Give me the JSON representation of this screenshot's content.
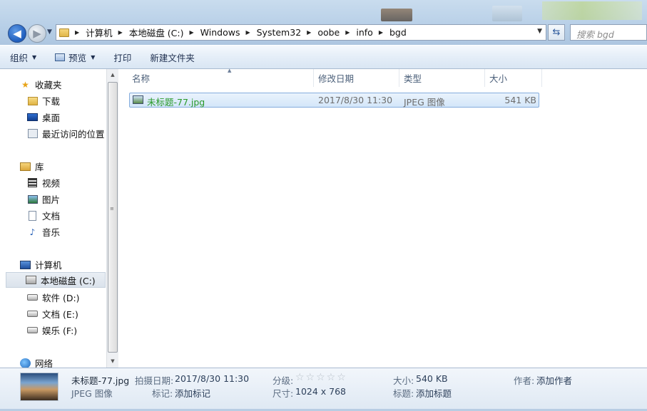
{
  "address": {
    "crumbs": [
      "计算机",
      "本地磁盘 (C:)",
      "Windows",
      "System32",
      "oobe",
      "info",
      "bgd"
    ],
    "search_placeholder": "搜索 bgd"
  },
  "toolbar": {
    "organize": "组织",
    "preview": "预览",
    "print": "打印",
    "new_folder": "新建文件夹"
  },
  "sidebar": {
    "favorites": "收藏夹",
    "downloads": "下载",
    "desktop": "桌面",
    "recent": "最近访问的位置",
    "libraries": "库",
    "videos": "视频",
    "pictures": "图片",
    "documents": "文档",
    "music": "音乐",
    "computer": "计算机",
    "drive_c": "本地磁盘 (C:)",
    "drive_d": "软件 (D:)",
    "drive_e": "文档 (E:)",
    "drive_f": "娱乐 (F:)",
    "network": "网络"
  },
  "columns": {
    "name": "名称",
    "modified": "修改日期",
    "type": "类型",
    "size": "大小"
  },
  "files": [
    {
      "name": "未标题-77.jpg",
      "modified": "2017/8/30 11:30",
      "type": "JPEG 图像",
      "size": "541 KB"
    }
  ],
  "details": {
    "filename": "未标题-77.jpg",
    "filetype": "JPEG 图像",
    "date_taken_label": "拍摄日期:",
    "date_taken": "2017/8/30 11:30",
    "tags_label": "标记:",
    "tags": "添加标记",
    "rating_label": "分级:",
    "rating_stars": "☆☆☆☆☆",
    "dimensions_label": "尺寸:",
    "dimensions": "1024 x 768",
    "size_label": "大小:",
    "size": "540 KB",
    "title_label": "标题:",
    "title": "添加标题",
    "author_label": "作者:",
    "author": "添加作者"
  }
}
